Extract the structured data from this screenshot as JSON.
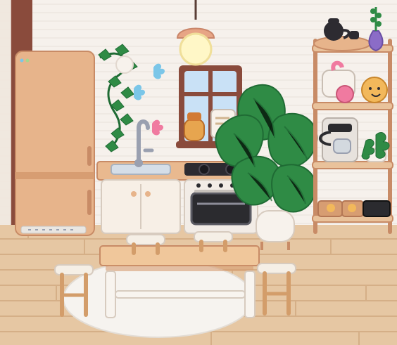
{
  "scene": {
    "title": "",
    "kind": "toca-boca-style kitchen room scene"
  },
  "colors": {
    "wall": "#f6f1ec",
    "wall_stripe": "#e8e1da",
    "wood_dark": "#8a4b3c",
    "floor_light": "#e6c7a3",
    "floor_line": "#d4ad84",
    "fridge": "#e7b48b",
    "fridge_shadow": "#d79d72",
    "counter_top": "#e9b98f",
    "cabinet": "#f7efe6",
    "oven": "#f2ece6",
    "leaf": "#2f8b45",
    "leaf_dark": "#1f6b34",
    "pot_white": "#f7f2ec",
    "lamp": "#e7a585",
    "rug": "#f6f3ef",
    "table_top": "#f0c79b",
    "table_legs": "#f8f4ef",
    "stool_wood": "#d39d6a",
    "stool_seat": "#f5efe6",
    "lavender_vase": "#8b6cc7"
  },
  "objects": {
    "fridge": "fridge",
    "kitchen_counter": "kitchen-counter",
    "stove": "stove",
    "oven": "oven",
    "window": "window",
    "pendant_lamp": "pendant-lamp",
    "shelf": "shelf",
    "monstera": "monstera-plant",
    "ivy": "ivy-plant",
    "table": "dining-table",
    "stools": [
      "stool-left",
      "stool-right",
      "stool-back-left",
      "stool-back-right"
    ],
    "rug": "round-rug",
    "espresso_machine": "espresso-machine",
    "stand_mixer": "stand-mixer",
    "tea_set": "tea-set",
    "egg_toy": "egg-toy",
    "succulent": "succulent",
    "lavender_vase": "lavender-vase",
    "storage_boxes": "storage-boxes"
  }
}
